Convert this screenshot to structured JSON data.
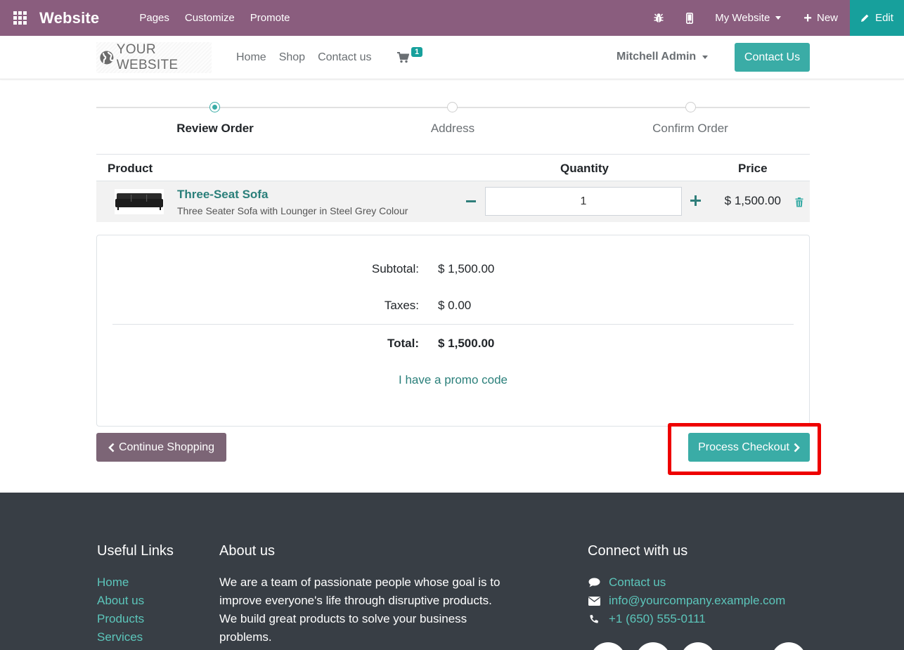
{
  "admin_bar": {
    "title": "Website",
    "menu": [
      "Pages",
      "Customize",
      "Promote"
    ],
    "my_website": "My Website",
    "new_label": "New",
    "edit_label": "Edit"
  },
  "header": {
    "logo_text": "YOUR WEBSITE",
    "nav": [
      "Home",
      "Shop",
      "Contact us"
    ],
    "cart_count": "1",
    "user": "Mitchell Admin",
    "contact_button": "Contact Us"
  },
  "wizard": {
    "steps": [
      "Review Order",
      "Address",
      "Confirm Order"
    ],
    "active_step": 0
  },
  "cart_table": {
    "headers": {
      "product": "Product",
      "quantity": "Quantity",
      "price": "Price"
    },
    "items": [
      {
        "name": "Three-Seat Sofa",
        "description": "Three Seater Sofa with Lounger in Steel Grey Colour",
        "quantity": "1",
        "price": "$ 1,500.00"
      }
    ]
  },
  "summary": {
    "subtotal_label": "Subtotal:",
    "subtotal_value": "$ 1,500.00",
    "taxes_label": "Taxes:",
    "taxes_value": "$ 0.00",
    "total_label": "Total:",
    "total_value": "$ 1,500.00",
    "promo_link": "I have a promo code"
  },
  "buttons": {
    "continue": "Continue Shopping",
    "checkout": "Process Checkout"
  },
  "footer": {
    "useful_links_title": "Useful Links",
    "useful_links": [
      "Home",
      "About us",
      "Products",
      "Services"
    ],
    "about_title": "About us",
    "about_text": "We are a team of passionate people whose goal is to improve everyone's life through disruptive products. We build great products to solve your business problems.",
    "connect_title": "Connect with us",
    "connect_contact": "Contact us",
    "connect_email": "info@yourcompany.example.com",
    "connect_phone": "+1 (650) 555-0111"
  },
  "colors": {
    "admin_bar": "#8a5d7e",
    "accent": "#3aaca6",
    "edit_button": "#17a09c",
    "continue_button": "#7c6576",
    "footer": "#383e45",
    "highlight": "#ee0000"
  },
  "icons": [
    "apps-grid-icon",
    "bug-icon",
    "mobile-icon",
    "plus-icon",
    "pencil-icon",
    "globe-icon",
    "cart-icon",
    "minus-icon",
    "trash-icon",
    "chevron-left-icon",
    "chevron-right-icon",
    "comment-icon",
    "envelope-icon",
    "phone-icon"
  ]
}
